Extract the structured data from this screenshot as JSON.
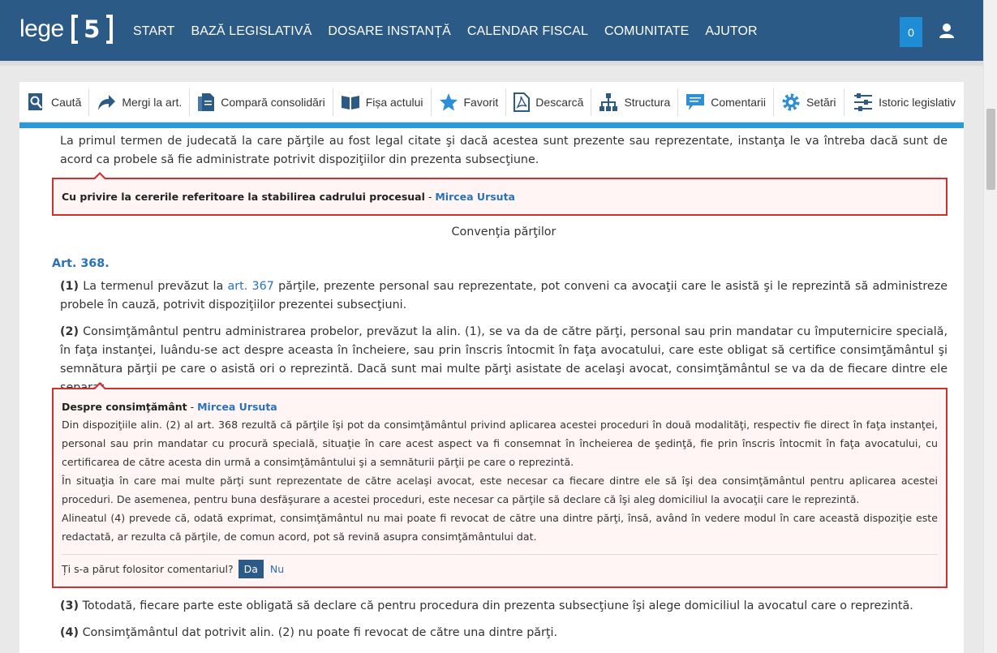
{
  "header": {
    "logo_text": "lege",
    "logo_number": "5",
    "nav": [
      "START",
      "BAZĂ LEGISLATIVĂ",
      "DOSARE INSTANȚĂ",
      "CALENDAR FISCAL",
      "COMUNITATE",
      "AJUTOR"
    ],
    "notification_count": "0",
    "user_icon": "user-icon"
  },
  "toolbar": {
    "items": [
      {
        "label": "Caută",
        "icon": "search-doc-icon"
      },
      {
        "label": "Mergi la art.",
        "icon": "go-arrow-icon"
      },
      {
        "label": "Compară consolidări",
        "icon": "compare-docs-icon"
      },
      {
        "label": "Fișa actului",
        "icon": "book-icon"
      },
      {
        "label": "Favorit",
        "icon": "star-icon"
      },
      {
        "label": "Descarcă",
        "icon": "pdf-icon"
      },
      {
        "label": "Structura",
        "icon": "tree-icon"
      },
      {
        "label": "Comentarii",
        "icon": "comment-icon"
      },
      {
        "label": "Setări",
        "icon": "gear-icon"
      }
    ],
    "history_label": "Istoric legislativ"
  },
  "content": {
    "intro": "La primul termen de judecată la care părţile au fost legal citate şi dacă acestea sunt prezente sau reprezentate, instanţa le va întreba dacă sunt de acord ca probele să fie administrate potrivit dispoziţiilor din prezenta subsecţiune.",
    "comment1": {
      "title": "Cu privire la cererile referitoare la stabilirea cadrului procesual",
      "separator": " - ",
      "author": "Mircea Ursuta"
    },
    "section_title": "Convenţia părţilor",
    "article_label": "Art. 368.",
    "p1": {
      "num": "(1)",
      "before": " La termenul prevăzut la ",
      "link": "art. 367",
      "after": " părţile, prezente personal sau reprezentate, pot conveni ca avocaţii care le asistă şi le reprezintă să administreze probele în cauză, potrivit dispoziţiilor prezentei subsecţiuni."
    },
    "p2": {
      "num": "(2)",
      "text": " Consimţământul pentru administrarea probelor, prevăzut la alin. (1), se va da de către părţi, personal sau prin mandatar cu împuternicire specială, în faţa instanţei, luându-se act despre aceasta în încheiere, sau prin înscris întocmit în faţa avocatului, care este obligat să certifice consimţământul şi semnătura părţii pe care o asistă ori o reprezintă. Dacă sunt mai multe părţi asistate de acelaşi avocat, consimţământul se va da de fiecare dintre ele separat."
    },
    "comment2": {
      "title": "Despre consimţământ",
      "separator": " - ",
      "author": "Mircea Ursuta",
      "paragraphs": [
        "Din dispoziţiile alin. (2) al art. 368 rezultă că părţile îşi pot da consimţământul privind aplicarea acestei proceduri în două modalităţi, respectiv fie direct în faţa instanţei, personal sau prin mandatar cu procură specială, situaţie în care acest aspect va fi consemnat în încheierea de şedinţă, fie prin înscris întocmit în faţa avocatului, cu certificarea de către acesta din urmă a consimţământului şi a semnăturii părţii pe care o reprezintă.",
        "În situaţia în care mai multe părţi sunt reprezentate de către acelaşi avocat, este necesar ca fiecare dintre ele să îşi dea consimţământul pentru aplicarea acestei proceduri. De asemenea, pentru buna desfăşurare a acestei proceduri, este necesar ca părţile să declare că îşi aleg domiciliul la avocaţii care le reprezintă.",
        "Alineatul (4) prevede că, odată exprimat, consimţământul nu mai poate fi revocat de către una dintre părţi, însă, având în vedere modul în care această dispoziţie este redactată, ar rezulta că părţile, de comun acord, pot să revină asupra consimţământului dat."
      ],
      "useful_question": "Ți s-a părut folositor comentariul?",
      "yes": "Da",
      "no": "Nu"
    },
    "p3": {
      "num": "(3)",
      "text": " Totodată, fiecare parte este obligată să declare că pentru procedura din prezenta subsecţiune îşi alege domiciliul la avocatul care o reprezintă."
    },
    "p4": {
      "num": "(4)",
      "text": " Consimţământul dat potrivit alin. (2) nu poate fi revocat de către una dintre părţi."
    }
  },
  "colors": {
    "header_bg": "#2c5a86",
    "accent_blue": "#2d9ad8",
    "link": "#2a72b8",
    "comment_border": "#d0302f"
  }
}
